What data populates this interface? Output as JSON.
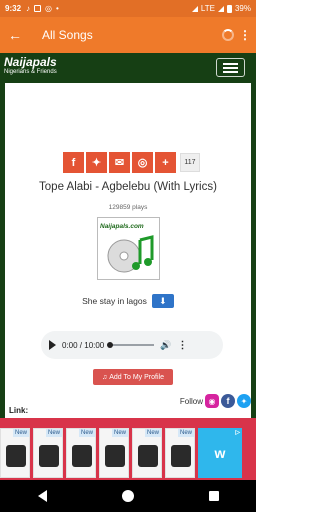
{
  "status_bar": {
    "time": "9:32",
    "network": "LTE",
    "battery": "39%"
  },
  "app_bar": {
    "title": "All Songs"
  },
  "site": {
    "name": "Naijapals",
    "tagline": "Nigerians & Friends"
  },
  "share": {
    "count": "117"
  },
  "song": {
    "title": "Tope Alabi - Agbelebu (With Lyrics)",
    "plays": "129859 plays",
    "art_label": "Naijapals.com",
    "lyric_line": "She stay in lagos"
  },
  "player": {
    "time": "0:00 / 10:00"
  },
  "actions": {
    "add_label": "Add To My Profile",
    "follow_label": "Follow",
    "link_label": "Link:"
  },
  "ad": {
    "badge": "New",
    "brand": "w"
  },
  "colors": {
    "orange": "#ef7a2a",
    "header_green": "#163f14",
    "share_red": "#e45434"
  }
}
